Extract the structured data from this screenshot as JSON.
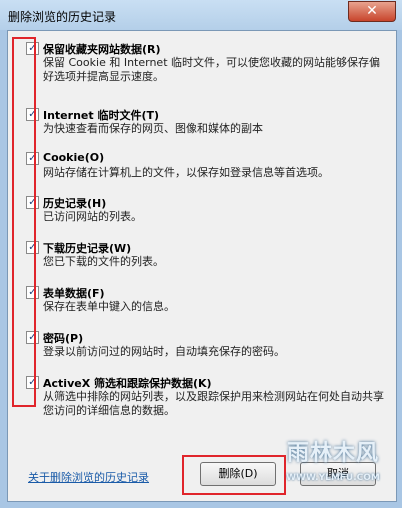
{
  "window": {
    "title": "删除浏览的历史记录",
    "close_glyph": "✕"
  },
  "items": [
    {
      "title": "保留收藏夹网站数据(R)",
      "desc": "保留 Cookie 和 Internet 临时文件，可以使您收藏的网站能够保存偏好选项并提高显示速度。",
      "checked": true
    },
    {
      "title": "Internet 临时文件(T)",
      "desc": "为快速查看而保存的网页、图像和媒体的副本",
      "checked": true
    },
    {
      "title": "Cookie(O)",
      "desc": "网站存储在计算机上的文件，以保存如登录信息等首选项。",
      "checked": true
    },
    {
      "title": "历史记录(H)",
      "desc": "已访问网站的列表。",
      "checked": true
    },
    {
      "title": "下载历史记录(W)",
      "desc": "您已下载的文件的列表。",
      "checked": true
    },
    {
      "title": "表单数据(F)",
      "desc": "保存在表单中键入的信息。",
      "checked": true
    },
    {
      "title": "密码(P)",
      "desc": "登录以前访问过的网站时，自动填充保存的密码。",
      "checked": true
    },
    {
      "title": "ActiveX 筛选和跟踪保护数据(K)",
      "desc": "从筛选中排除的网站列表，以及跟踪保护用来检测网站在何处自动共享您访问的详细信息的数据。",
      "checked": true
    }
  ],
  "footer": {
    "link_text": "关于删除浏览的历史记录",
    "delete_button": "删除(D)",
    "cancel_button": "取消"
  },
  "watermark": {
    "logo": "雨林木风",
    "url": "WWW.YLMFU.COM"
  },
  "colors": {
    "highlight": "#e0252b",
    "link": "#1a5ba8"
  }
}
